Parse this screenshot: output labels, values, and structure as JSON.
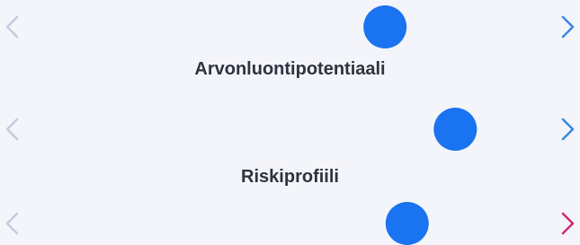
{
  "sliders": [
    {
      "id": "slider-1",
      "value": 0.667,
      "color_start": "#c5cbe0",
      "color_end": "#3a86e6",
      "thumb_color": "#1a73f0"
    },
    {
      "id": "slider-arvonluontipotentiaali",
      "label": "Arvonluontipotentiaali",
      "value": 0.791,
      "color_start": "#c5cbe0",
      "color_end": "#3a86e6",
      "thumb_color": "#1a73f0"
    },
    {
      "id": "slider-riskiprofiili",
      "label": "Riskiprofiili",
      "value": 0.706,
      "color_start": "#c5cbe0",
      "color_end": "#d0287a",
      "thumb_color": "#1a73f0"
    }
  ],
  "icons": {
    "left_end": "chevron-left-icon",
    "right_end": "chevron-right-icon"
  }
}
